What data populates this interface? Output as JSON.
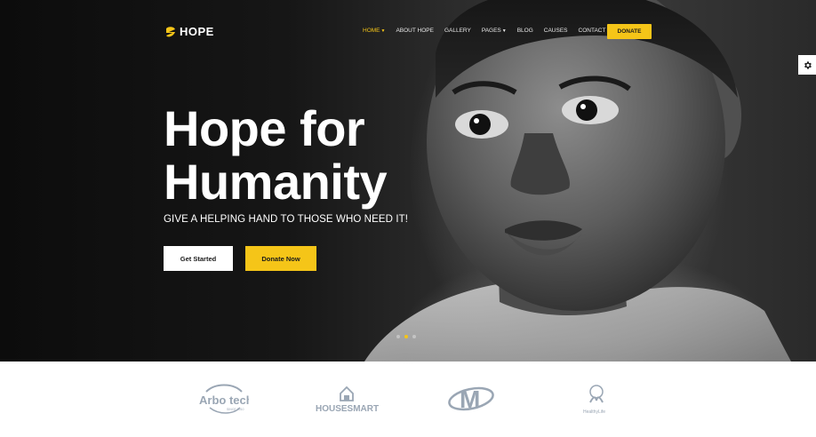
{
  "brand": {
    "name": "HOPE",
    "accent": "#f5c518"
  },
  "nav": {
    "items": [
      {
        "label": "HOME",
        "active": true,
        "dropdown": true
      },
      {
        "label": "ABOUT HOPE",
        "active": false,
        "dropdown": false
      },
      {
        "label": "GALLERY",
        "active": false,
        "dropdown": false
      },
      {
        "label": "PAGES",
        "active": false,
        "dropdown": true
      },
      {
        "label": "BLOG",
        "active": false,
        "dropdown": false
      },
      {
        "label": "CAUSES",
        "active": false,
        "dropdown": false
      },
      {
        "label": "CONTACT",
        "active": false,
        "dropdown": false
      }
    ],
    "donate_label": "DONATE"
  },
  "hero": {
    "title_line1": "Hope for",
    "title_line2": "Humanity",
    "tagline": "GIVE A HELPING HAND TO THOSE WHO NEED IT!",
    "primary_button": "Get Started",
    "secondary_button": "Donate Now",
    "slider_dots": 3,
    "active_dot": 2
  },
  "settings": {
    "icon": "gear-icon"
  },
  "partners": {
    "logos": [
      {
        "name": "arbotech-logo",
        "text": "Arbo tech",
        "subtext": "SINCE 2010"
      },
      {
        "name": "housesmart-logo",
        "text": "HOUSESMART",
        "subtext": ""
      },
      {
        "name": "m-logo",
        "text": "M",
        "subtext": ""
      },
      {
        "name": "healthylife-logo",
        "text": "HealthyLife",
        "subtext": ""
      }
    ],
    "logo_color": "#9aa6b4"
  }
}
